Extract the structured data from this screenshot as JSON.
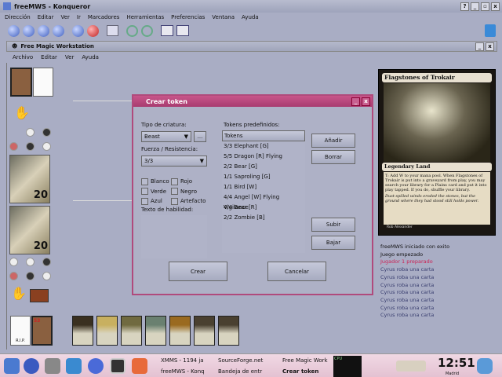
{
  "window": {
    "title": "freeMWS - Konqueror",
    "controls": [
      "?",
      "_",
      "▫",
      "x"
    ]
  },
  "menubar": [
    "Dirección",
    "Editar",
    "Ver",
    "Ir",
    "Marcadores",
    "Herramientas",
    "Preferencias",
    "Ventana",
    "Ayuda"
  ],
  "inner_window": {
    "title": "Free Magic Workstation",
    "menu": [
      "Archivo",
      "Editar",
      "Ver",
      "Ayuda"
    ]
  },
  "players": [
    {
      "life": "20"
    },
    {
      "life": "20"
    }
  ],
  "graveyard_label": "R.I.P.",
  "library_count": "53",
  "dialog": {
    "title": "Crear token",
    "creature_type_label": "Tipo de criatura:",
    "creature_type_value": "Beast",
    "ellipsis_button": "...",
    "pt_label": "Fuerza / Resistencia:",
    "pt_value": "3/3",
    "colors": [
      "Blanco",
      "Rojo",
      "Verde",
      "Negro",
      "Azul",
      "Artefacto"
    ],
    "ability_label": "Texto de habilidad:",
    "predefined_label": "Tokens predefinidos:",
    "list_header": "Tokens",
    "tokens": [
      "3/3 Elephant [G]",
      "5/5 Dragon [R] Flying",
      "2/2 Bear [G]",
      "1/1 Saproling [G]",
      "1/1 Bird [W]",
      "4/4 Angel [W] Flying Vigilance",
      "4/4 Bear [R]",
      "2/2 Zombie [B]"
    ],
    "add": "Añadir",
    "delete": "Borrar",
    "up": "Subir",
    "down": "Bajar",
    "create": "Crear",
    "cancel": "Cancelar"
  },
  "card": {
    "name": "Flagstones of Trokair",
    "type": "Legendary Land",
    "rules": "T: Add W to your mana pool. When Flagstones of Trokair is put into a graveyard from play, you may search your library for a Plains card and put it into play tapped. If you do, shuffle your library.",
    "flavor": "Dust-spilled winds eroded the stones, but the ground where they had stood still holds power.",
    "artist": "Rob Alexander"
  },
  "log": [
    {
      "text": "freeMWS iniciado con exito",
      "color": "#111111"
    },
    {
      "text": "Juego empezado",
      "color": "#111111"
    },
    {
      "text": "Jugador 1 preparado",
      "color": "#cc2255"
    },
    {
      "text": "Cyrus roba una carta",
      "color": "#3a3f70"
    },
    {
      "text": "Cyrus roba una carta",
      "color": "#3a3f70"
    },
    {
      "text": "Cyrus roba una carta",
      "color": "#3a3f70"
    },
    {
      "text": "Cyrus roba una carta",
      "color": "#3a3f70"
    },
    {
      "text": "Cyrus roba una carta",
      "color": "#3a3f70"
    },
    {
      "text": "Cyrus roba una carta",
      "color": "#3a3f70"
    },
    {
      "text": "Cyrus roba una carta",
      "color": "#3a3f70"
    }
  ],
  "taskbar": {
    "tasks": [
      "XMMS - 1194 ja",
      "SourceForge.net",
      "Free Magic Work",
      "freeMWS - Konq",
      "Bandeja de entr",
      "Crear token"
    ],
    "cpu_label": "CPU",
    "clock": "12:51",
    "clock_location": "Madrid"
  }
}
